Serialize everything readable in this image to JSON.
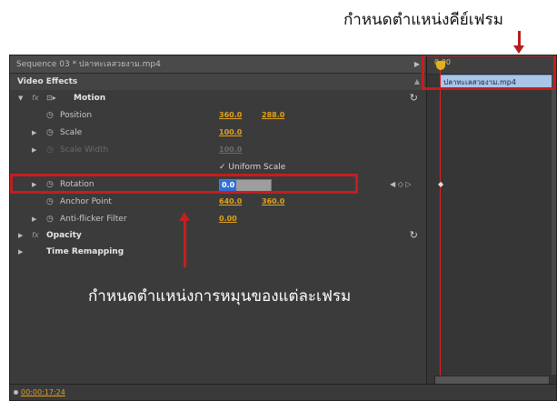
{
  "annotations": {
    "keyframe_label": "กำหนดตำแหน่งคีย์เฟรม",
    "rotation_label": "กำหนดตำแหน่งการหมุนของแต่ละเฟรม"
  },
  "panel": {
    "sequence_title": "Sequence 03 * ปลาทะเลสวยงาม.mp4",
    "section_title": "Video Effects",
    "footer_timecode": "00:00:17:24"
  },
  "effects": {
    "motion": {
      "name": "Motion"
    },
    "position": {
      "label": "Position",
      "x": "360.0",
      "y": "288.0"
    },
    "scale": {
      "label": "Scale",
      "value": "100.0"
    },
    "scale_width": {
      "label": "Scale Width",
      "value": "100.0"
    },
    "uniform_scale": {
      "label": "Uniform Scale",
      "checked": true
    },
    "rotation": {
      "label": "Rotation",
      "value": "0.0"
    },
    "anchor_point": {
      "label": "Anchor Point",
      "x": "640.0",
      "y": "360.0"
    },
    "anti_flicker": {
      "label": "Anti-flicker Filter",
      "value": "0.00"
    },
    "opacity": {
      "name": "Opacity"
    },
    "time_remapping": {
      "name": "Time Remapping"
    }
  },
  "timeline": {
    "time_label": "0:00",
    "clip_name": "ปลาทะเลสวยงาม.mp4"
  },
  "colors": {
    "panel_bg": "#3b3b3b",
    "value_orange": "#e3a21a",
    "highlight_red": "#c41e1e",
    "clip_blue": "#a9c5e8",
    "selection_blue": "#2f6fd6"
  },
  "icons": {
    "disclosure": "triangle-icon",
    "fx": "fx-badge-icon",
    "stopwatch": "stopwatch-icon",
    "reset": "reset-icon",
    "keyframe": "diamond-icon",
    "playhead": "playhead-icon"
  }
}
